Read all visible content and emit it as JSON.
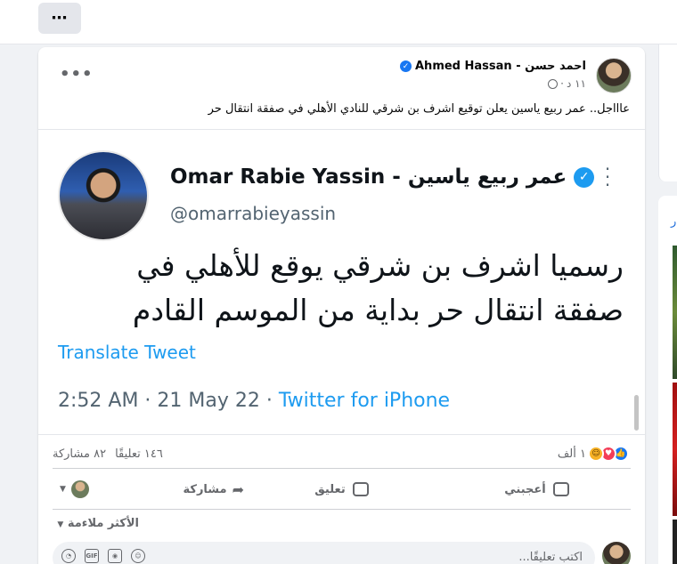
{
  "topbar": {
    "more_label": "⋯"
  },
  "right_panel": {
    "partial_label": "ر"
  },
  "post": {
    "author_name": "احمد حسن - Ahmed Hassan",
    "time": "١١ د",
    "text": "عاااجل.. عمر ربيع ياسين يعلن توقيع اشرف بن شرقي للنادي الأهلي في صفقة انتقال حر",
    "more_label": "•••"
  },
  "tweet": {
    "display_name": "Omar Rabie Yassin - عمر ربيع ياسين",
    "handle": "@omarrabieyassin",
    "body": "رسميا اشرف بن شرقي يوقع للأهلي في صفقة انتقال حر بداية من الموسم القادم",
    "translate_label": "Translate Tweet",
    "timestamp": "2:52 AM · 21 May 22 · ",
    "source": "Twitter for iPhone"
  },
  "stats": {
    "reactions_count": "١ ألف",
    "comments_count": "١٤٦ تعليقًا",
    "shares_count": "٨٢ مشاركة"
  },
  "actions": {
    "like_label": "أعجبني",
    "comment_label": "تعليق",
    "share_label": "مشاركة"
  },
  "comments": {
    "sort_label": "الأكثر ملاءمة",
    "input_placeholder": "اكتب تعليقًا..."
  },
  "colors": {
    "facebook_blue": "#1877f2",
    "twitter_blue": "#1d9bf0",
    "background": "#f0f2f5"
  }
}
